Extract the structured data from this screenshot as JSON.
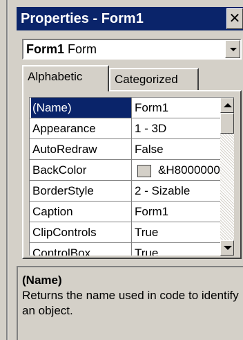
{
  "window": {
    "title": "Properties - Form1",
    "close_glyph": "✕"
  },
  "object_selector": {
    "name": "Form1",
    "type": "Form"
  },
  "tabs": [
    {
      "label": "Alphabetic",
      "active": true
    },
    {
      "label": "Categorized",
      "active": false
    }
  ],
  "properties": [
    {
      "name": "(Name)",
      "value": "Form1",
      "selected": true
    },
    {
      "name": "Appearance",
      "value": "1 - 3D"
    },
    {
      "name": "AutoRedraw",
      "value": "False"
    },
    {
      "name": "BackColor",
      "value": "&H8000000"
    },
    {
      "name": "BorderStyle",
      "value": "2 - Sizable"
    },
    {
      "name": "Caption",
      "value": "Form1"
    },
    {
      "name": "ClipControls",
      "value": "True"
    },
    {
      "name": "ControlBox",
      "value": "True"
    }
  ],
  "description": {
    "heading": "(Name)",
    "text": "Returns the name used in code to identify an object."
  },
  "colors": {
    "title_bar": "#0a246a",
    "face": "#d4d0c8"
  }
}
